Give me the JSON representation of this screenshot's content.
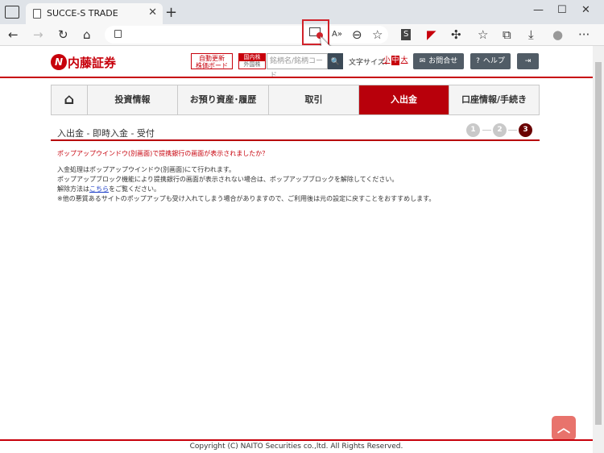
{
  "browser": {
    "tab_title": "SUCCE-S TRADE",
    "tab_close": "✕",
    "new_tab": "+",
    "window_controls": {
      "minimize": "—",
      "maximize": "☐",
      "close": "✕"
    },
    "toolbar_icons": {
      "back": "←",
      "forward": "→",
      "refresh": "↻",
      "home": "⌂",
      "read_aloud": "A»",
      "zoom": "⊖",
      "favorites_add": "☆",
      "ext_s": "S",
      "ext_flag": "◤",
      "extensions": "✣",
      "favorites": "☆",
      "collections": "⧉",
      "downloads": "⤓",
      "profile": "●",
      "more": "···"
    }
  },
  "header": {
    "logo_mark": "N",
    "logo_text": "内藤証券",
    "board_line1": "自動更新",
    "board_line2": "株価ボード",
    "market_domestic": "国内株",
    "market_foreign": "外国株",
    "search_placeholder": "銘柄名/銘柄コード",
    "search_icon": "🔍",
    "font_size_label": "文字サイズ:",
    "font_small": "小",
    "font_medium": "中",
    "font_large": "大",
    "contact_label": "お問合せ",
    "help_label": "ヘルプ",
    "logout_icon": "⇥"
  },
  "nav": {
    "home_icon": "⌂",
    "items": [
      {
        "label": "投資情報"
      },
      {
        "label": "お預り資産･履歴"
      },
      {
        "label": "取引"
      },
      {
        "label": "入出金"
      },
      {
        "label": "口座情報/手続き"
      }
    ],
    "active_index": 3
  },
  "page": {
    "title": "入出金 - 即時入金 - 受付",
    "steps": [
      "1",
      "2",
      "3"
    ],
    "current_step": 3,
    "notice": "ポップアップウインドウ(別画面)で提携銀行の画面が表示されましたか？",
    "line1": "入金処理はポップアップウインドウ(別画面)にて行われます。",
    "line2": "ポップアップブロック機能により提携銀行の画面が表示されない場合は、ポップアップブロックを解除してください。",
    "line3_prefix": "解除方法は",
    "line3_link": "こちら",
    "line3_suffix": "をご覧ください。",
    "line4": "※他の悪質あるサイトのポップアップも受け入れてしまう場合がありますので、ご利用後は元の設定に戻すことをおすすめします。"
  },
  "footer": {
    "pagetop_icon": "︿",
    "copyright": "Copyright (C) NAITO Securities co.,ltd. All Rights Reserved."
  },
  "colors": {
    "brand_red": "#c7000b",
    "nav_active": "#b8000b",
    "header_btn": "#515c66"
  }
}
